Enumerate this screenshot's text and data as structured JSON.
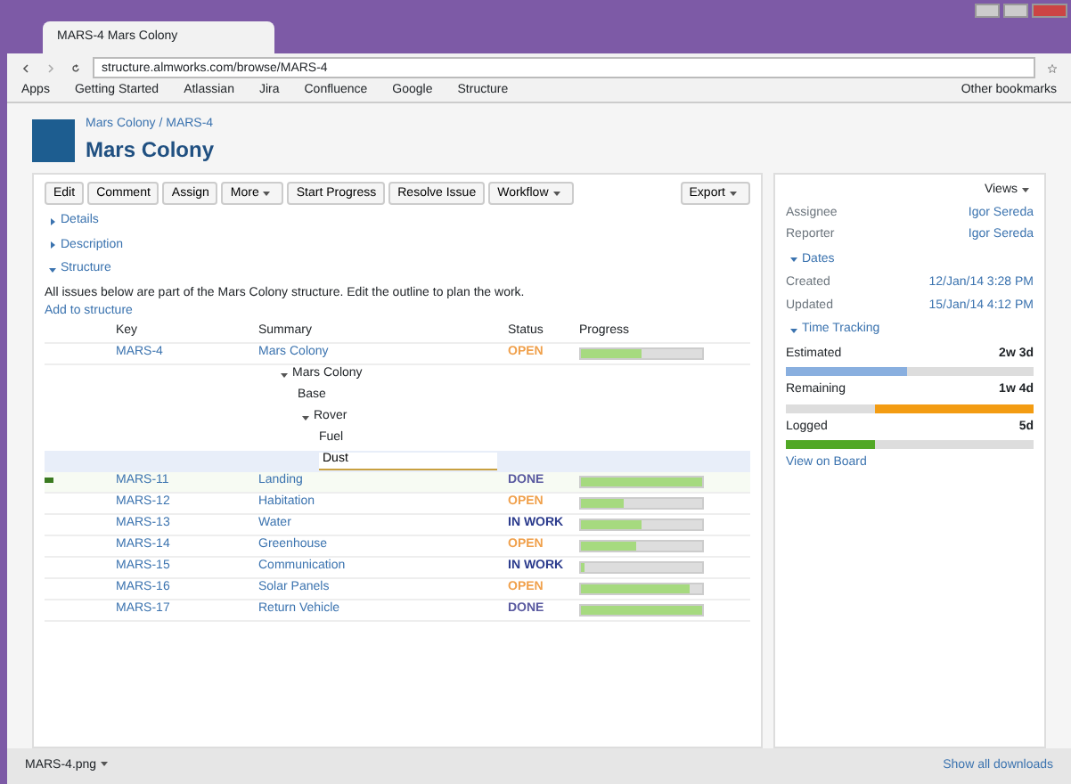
{
  "browser": {
    "tab_title": "MARS-4 Mars Colony",
    "address": "structure.almworks.com/browse/MARS-4",
    "bookmarks": [
      "Apps",
      "Getting Started",
      "Atlassian",
      "Jira",
      "Confluence",
      "Google",
      "Structure"
    ],
    "other_bookmarks": "Other bookmarks"
  },
  "issue": {
    "breadcrumb": "Mars Colony / MARS-4",
    "title": "Mars Colony"
  },
  "toolbar": [
    {
      "label": "Edit",
      "kind": "button"
    },
    {
      "label": "Comment",
      "kind": "button"
    },
    {
      "label": "Assign",
      "kind": "button"
    },
    {
      "label": "More",
      "kind": "dropdown"
    },
    {
      "label": "Start Progress",
      "kind": "button"
    },
    {
      "label": "Resolve Issue",
      "kind": "button"
    },
    {
      "label": "Workflow",
      "kind": "dropdown"
    }
  ],
  "export_label": "Export",
  "sections": [
    {
      "label": "Details",
      "expanded": false
    },
    {
      "label": "Description",
      "expanded": false
    },
    {
      "label": "Structure",
      "expanded": true
    }
  ],
  "structure": {
    "note": "All issues below are part of the Mars Colony structure. Edit the outline to plan the work.",
    "add_link": "Add to structure",
    "columns": [
      "Key",
      "Summary",
      "Status",
      "Progress"
    ],
    "top_row": {
      "key": "MARS-4",
      "summary": "Mars Colony",
      "status": "OPEN",
      "color": "#f0a04b",
      "level": 0.5
    },
    "outline": [
      {
        "label": "Mars Colony",
        "children": [
          {
            "label": "Base"
          },
          {
            "label": "Rover",
            "children": [
              {
                "label": "Fuel"
              },
              {
                "label": "Dust",
                "editing": true
              }
            ]
          }
        ]
      }
    ],
    "rows": [
      {
        "key": "MARS-11",
        "summary": "Landing",
        "status": "DONE",
        "color": "#5a5aa0",
        "level": 1.0,
        "flagged": true
      },
      {
        "key": "MARS-12",
        "summary": "Habitation",
        "status": "OPEN",
        "color": "#f0a04b",
        "level": 0.35,
        "flagged": false
      },
      {
        "key": "MARS-13",
        "summary": "Water",
        "status": "IN WORK",
        "color": "#2a3a8c",
        "level": 0.5,
        "flagged": false
      },
      {
        "key": "MARS-14",
        "summary": "Greenhouse",
        "status": "OPEN",
        "color": "#f0a04b",
        "level": 0.45,
        "flagged": false
      },
      {
        "key": "MARS-15",
        "summary": "Communication",
        "status": "IN WORK",
        "color": "#2a3a8c",
        "level": 0.03,
        "flagged": false
      },
      {
        "key": "MARS-16",
        "summary": "Solar Panels",
        "status": "OPEN",
        "color": "#f0a04b",
        "level": 0.9,
        "flagged": false
      },
      {
        "key": "MARS-17",
        "summary": "Return Vehicle",
        "status": "DONE",
        "color": "#5a5aa0",
        "level": 1.0,
        "flagged": false
      }
    ]
  },
  "sidebar": {
    "view_label": "Views",
    "people": [
      {
        "label": "Assignee",
        "value": "Igor Sereda"
      },
      {
        "label": "Reporter",
        "value": "Igor Sereda"
      }
    ],
    "dates_title": "Dates",
    "dates": [
      {
        "label": "Created",
        "value": "12/Jan/14 3:28 PM"
      },
      {
        "label": "Updated",
        "value": "15/Jan/14 4:12 PM"
      }
    ],
    "time_title": "Time Tracking",
    "time": [
      {
        "label": "Estimated",
        "value": "2w 3d",
        "level": 0.49,
        "color": "#89afdf"
      },
      {
        "label": "Remaining",
        "value": "1w 4d",
        "level": 0.64,
        "color": "#f39c12"
      },
      {
        "label": "Logged",
        "value": "5d",
        "level": 0.36,
        "color": "#51a825"
      }
    ],
    "board_link": "View on Board"
  },
  "downloads": {
    "file": "MARS-4.png",
    "show_all": "Show all downloads"
  }
}
